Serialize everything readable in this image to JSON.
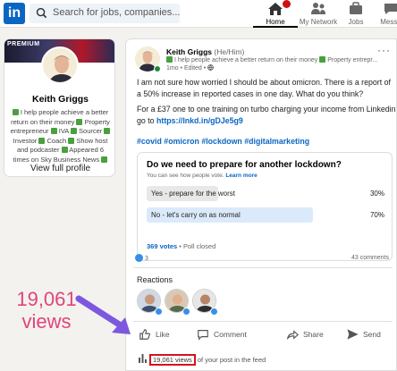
{
  "nav": {
    "search_placeholder": "Search for jobs, companies...",
    "items": [
      {
        "label": "Home",
        "icon": "home-icon",
        "active": true
      },
      {
        "label": "My Network",
        "icon": "network-icon",
        "active": false
      },
      {
        "label": "Jobs",
        "icon": "briefcase-icon",
        "active": false
      },
      {
        "label": "Messa",
        "icon": "message-icon",
        "active": false
      }
    ]
  },
  "profile": {
    "cover_text": "PREMIUM",
    "name": "Keith Griggs",
    "headline": [
      "I help people achieve a better return on their money",
      "Property entrepreneur",
      "IVA",
      "Sourcer",
      "Investor",
      "Coach",
      "Show host and podcaster",
      "Appeared 6 times on Sky Business News"
    ],
    "link": "View full profile"
  },
  "post": {
    "author": "Keith Griggs",
    "pronoun": "(He/Him)",
    "subheadline": "I help people achieve a better return on their money",
    "subheadline_suffix": "Property entrepr...",
    "meta": "1mo • Edited •",
    "more": "···",
    "paragraph1": "I am not sure how worried I should be about omicron. There is a report of a 50% increase in reported cases in one day. What do you think?",
    "paragraph2": "For a £37 one to one training on turbo charging your income from Linkedin go to",
    "paragraph2_link": "https://lnkd.in/gDJe5g9",
    "hashtags": "#covid #omicron #lockdown #digitalmarketing",
    "poll": {
      "question": "Do we need to prepare for another lockdown?",
      "subtext": "You can see how people vote.",
      "learn_more": "Learn more",
      "options": [
        {
          "label": "Yes - prepare for the worst",
          "percent_text": "30%",
          "percent": 30
        },
        {
          "label": "No - let's carry on as normal",
          "percent_text": "70%",
          "percent": 70
        }
      ],
      "votes": "369 votes",
      "status": "• Poll closed"
    },
    "reaction_count": "3",
    "comments": "43 comments",
    "reactions_title": "Reactions",
    "actions": {
      "like": "Like",
      "comment": "Comment",
      "share": "Share",
      "send": "Send"
    },
    "views": "19,061 views",
    "views_suffix": "of your post in the feed"
  },
  "annotation": {
    "line1": "19,061",
    "line2": "views",
    "color": "#e0457b"
  }
}
